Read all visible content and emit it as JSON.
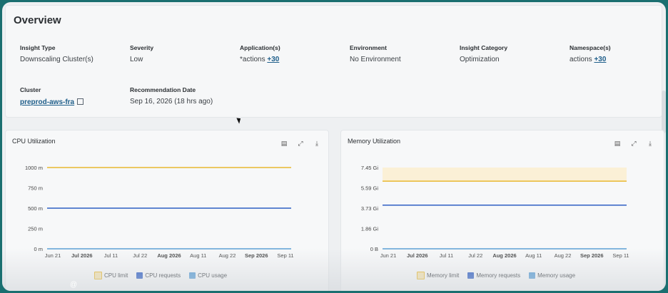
{
  "overview": {
    "title": "Overview",
    "fields": [
      {
        "label": "Insight Type",
        "value": "Downscaling Cluster(s)"
      },
      {
        "label": "Severity",
        "value": "Low"
      },
      {
        "label": "Application(s)",
        "value": "*actions",
        "extra": "+30"
      },
      {
        "label": "Environment",
        "value": "No Environment"
      },
      {
        "label": "Insight Category",
        "value": "Optimization"
      },
      {
        "label": "Namespace(s)",
        "value": "actions",
        "extra": "+30"
      },
      {
        "label": "Cluster",
        "value": "preprod-aws-fra"
      },
      {
        "label": "Recommendation Date",
        "value": "Sep 16, 2026 (18 hrs ago)"
      }
    ]
  },
  "chart_data": [
    {
      "type": "line",
      "title": "CPU Utilization",
      "x_ticks": [
        "Jun 21",
        "Jul 2026",
        "Jul 11",
        "Jul 22",
        "Aug 2026",
        "Aug 11",
        "Aug 22",
        "Sep 2026",
        "Sep 11"
      ],
      "x_ticks_bold": [
        "Jul 2026",
        "Aug 2026",
        "Sep 2026"
      ],
      "y_ticks": [
        "1000 m",
        "750 m",
        "500 m",
        "250 m",
        "0 m"
      ],
      "ylim": [
        0,
        1000
      ],
      "series": [
        {
          "name": "CPU limit",
          "value": 1000,
          "color": "#e8b830"
        },
        {
          "name": "CPU requests",
          "value": 500,
          "color": "#2f5fc4"
        },
        {
          "name": "CPU usage",
          "value": 0,
          "color": "#5b9fd6"
        }
      ],
      "legend": "bottom-center",
      "grid": false
    },
    {
      "type": "line",
      "title": "Memory Utilization",
      "x_ticks": [
        "Jun 21",
        "Jul 2026",
        "Jul 11",
        "Jul 22",
        "Aug 2026",
        "Aug 11",
        "Aug 22",
        "Sep 2026",
        "Sep 11"
      ],
      "x_ticks_bold": [
        "Jul 2026",
        "Aug 2026",
        "Sep 2026"
      ],
      "y_ticks": [
        "7.45 Gi",
        "5.59 Gi",
        "3.73 Gi",
        "1.86 Gi",
        "0 B"
      ],
      "ylim": [
        0,
        7.45
      ],
      "band": {
        "from": 6.2,
        "to": 7.45,
        "color": "#fbf0d6"
      },
      "series": [
        {
          "name": "Memory limit",
          "value": 6.2,
          "color": "#e8b830"
        },
        {
          "name": "Memory requests",
          "value": 4.0,
          "color": "#2f5fc4"
        },
        {
          "name": "Memory usage",
          "value": 0,
          "color": "#5b9fd6"
        }
      ],
      "legend": "bottom-center",
      "grid": false
    }
  ],
  "misc": {
    "at_sign": "@"
  }
}
